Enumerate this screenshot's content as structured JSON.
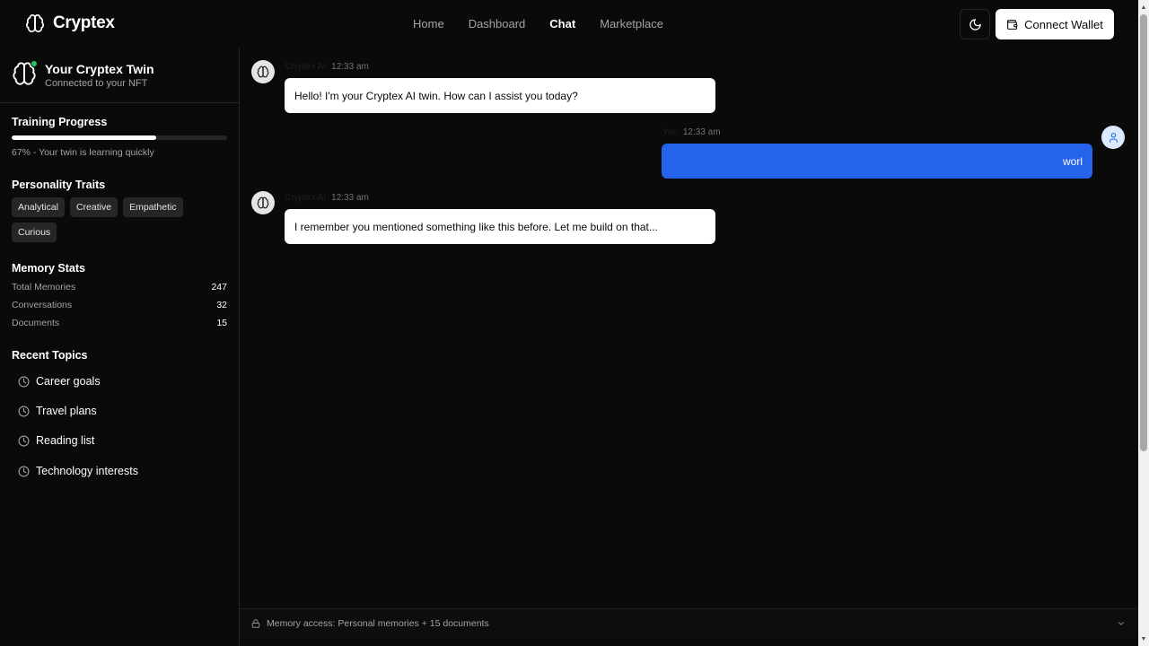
{
  "header": {
    "brand": "Cryptex",
    "nav": [
      {
        "label": "Home",
        "active": false
      },
      {
        "label": "Dashboard",
        "active": false
      },
      {
        "label": "Chat",
        "active": true
      },
      {
        "label": "Marketplace",
        "active": false
      }
    ],
    "theme_icon": "moon-icon",
    "wallet_label": "Connect Wallet",
    "wallet_icon": "wallet-icon"
  },
  "sidebar": {
    "twin_title": "Your Cryptex Twin",
    "twin_subtitle": "Connected to your NFT",
    "training": {
      "title": "Training Progress",
      "progress": 0.67,
      "text": "67% - Your twin is learning quickly"
    },
    "traits": {
      "title": "Personality Traits",
      "items": [
        "Analytical",
        "Creative",
        "Empathetic",
        "Curious"
      ]
    },
    "memory_stats": {
      "title": "Memory Stats",
      "rows": [
        {
          "label": "Total Memories",
          "value": "247"
        },
        {
          "label": "Conversations",
          "value": "32"
        },
        {
          "label": "Documents",
          "value": "15"
        }
      ]
    },
    "recent_topics": {
      "title": "Recent Topics",
      "items": [
        "Career goals",
        "Travel plans",
        "Reading list",
        "Technology interests"
      ]
    }
  },
  "chat": {
    "messages": [
      {
        "sender": "Cryptex AI",
        "time": "12:33 am",
        "text": "Hello! I'm your Cryptex AI twin. How can I assist you today?",
        "role": "bot"
      },
      {
        "sender": "You",
        "time": "12:33 am",
        "text": "worl",
        "role": "user"
      },
      {
        "sender": "Cryptex AI",
        "time": "12:33 am",
        "text": "I remember you mentioned something like this before. Let me build on that...",
        "role": "bot"
      }
    ]
  },
  "memory_access": {
    "text": "Memory access: Personal memories + 15 documents"
  },
  "colors": {
    "background": "#0a0a0a",
    "accent_user_bubble": "#2563eb",
    "online": "#22c55e"
  }
}
